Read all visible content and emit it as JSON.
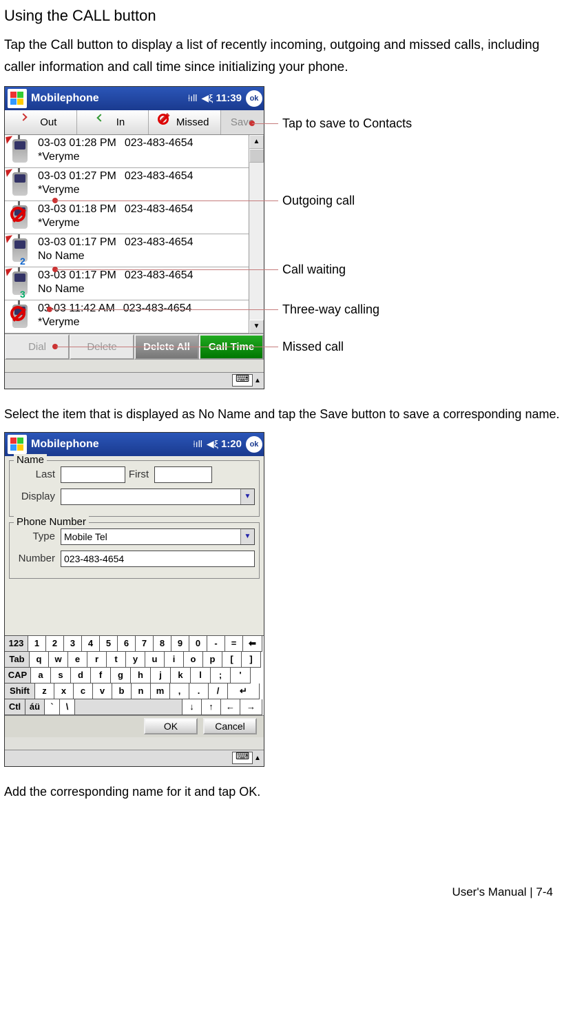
{
  "heading": "Using the CALL button",
  "intro": "Tap the Call button to display a list of recently incoming, outgoing and missed calls, including caller information and call time since initializing your phone.",
  "screenshot1": {
    "title": "Mobilephone",
    "time": "11:39",
    "okLabel": "ok",
    "tabs": {
      "out": "Out",
      "in": "In",
      "missed": "Missed",
      "save": "Save"
    },
    "rows": [
      {
        "datetime": "03-03 01:28 PM",
        "number": "023-483-4654",
        "name": "*Veryme",
        "type": "out"
      },
      {
        "datetime": "03-03 01:27 PM",
        "number": "023-483-4654",
        "name": "*Veryme",
        "type": "out"
      },
      {
        "datetime": "03-03 01:18 PM",
        "number": "023-483-4654",
        "name": "*Veryme",
        "type": "missed"
      },
      {
        "datetime": "03-03 01:17 PM",
        "number": "023-483-4654",
        "name": "No Name",
        "type": "waiting2"
      },
      {
        "datetime": "03-03 01:17 PM",
        "number": "023-483-4654",
        "name": "No Name",
        "type": "three3"
      },
      {
        "datetime": "03-03 11:42 AM",
        "number": "023-483-4654",
        "name": "*Veryme",
        "type": "missed"
      }
    ],
    "buttons": {
      "dial": "Dial",
      "delete": "Delete",
      "deleteAll": "Delete All",
      "callTime": "Call Time"
    }
  },
  "callouts1": {
    "save": "Tap to save to Contacts",
    "outgoing": "Outgoing call",
    "waiting": "Call waiting",
    "threeway": "Three-way calling",
    "missed": "Missed call"
  },
  "para2": "Select the item that is displayed as No Name and tap the Save button to save a corresponding name.",
  "screenshot2": {
    "title": "Mobilephone",
    "time": "1:20",
    "okLabel": "ok",
    "nameLegend": "Name",
    "lastLabel": "Last",
    "firstLabel": "First",
    "displayLabel": "Display",
    "phoneLegend": "Phone Number",
    "typeLabel": "Type",
    "typeValue": "Mobile Tel",
    "numberLabel": "Number",
    "numberValue": "023-483-4654",
    "okBtn": "OK",
    "cancelBtn": "Cancel",
    "kb": {
      "r1": [
        "123",
        "1",
        "2",
        "3",
        "4",
        "5",
        "6",
        "7",
        "8",
        "9",
        "0",
        "-",
        "=",
        "⬅"
      ],
      "r2": [
        "Tab",
        "q",
        "w",
        "e",
        "r",
        "t",
        "y",
        "u",
        "i",
        "o",
        "p",
        "[",
        "]"
      ],
      "r3": [
        "CAP",
        "a",
        "s",
        "d",
        "f",
        "g",
        "h",
        "j",
        "k",
        "l",
        ";",
        "'"
      ],
      "r4": [
        "Shift",
        "z",
        "x",
        "c",
        "v",
        "b",
        "n",
        "m",
        ",",
        ".",
        "/",
        "↵"
      ],
      "r5": [
        "Ctl",
        "áü",
        "`",
        "\\",
        " ",
        "↓",
        "↑",
        "←",
        "→"
      ]
    }
  },
  "para3": "Add the corresponding name for it and tap OK.",
  "footer": "User's Manual  |  7-4"
}
